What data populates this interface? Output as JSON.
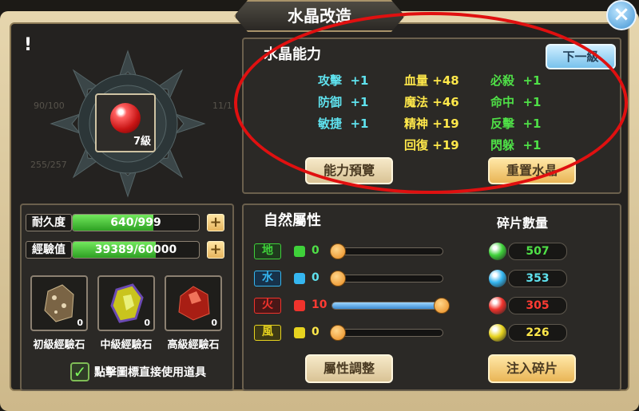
{
  "window": {
    "title": "水晶改造",
    "close_label": "×",
    "warning_label": "!"
  },
  "crystal": {
    "level_label": "7級"
  },
  "ghost_text": [
    "90/100",
    "11/1",
    "255/257"
  ],
  "ability": {
    "title": "水晶能力",
    "next_level_button": "下一級",
    "stats": [
      {
        "label": "攻擊",
        "value": "+1",
        "color": "cyan"
      },
      {
        "label": "防御",
        "value": "+1",
        "color": "cyan"
      },
      {
        "label": "敏捷",
        "value": "+1",
        "color": "cyan"
      },
      {
        "label": "血量",
        "value": "+48",
        "color": "yellow"
      },
      {
        "label": "魔法",
        "value": "+46",
        "color": "yellow"
      },
      {
        "label": "精神",
        "value": "+19",
        "color": "yellow"
      },
      {
        "label": "回復",
        "value": "+19",
        "color": "yellow"
      },
      {
        "label": "必殺",
        "value": "+1",
        "color": "green"
      },
      {
        "label": "命中",
        "value": "+1",
        "color": "green"
      },
      {
        "label": "反擊",
        "value": "+1",
        "color": "green"
      },
      {
        "label": "閃躲",
        "value": "+1",
        "color": "green"
      }
    ],
    "preview_button": "能力預覽",
    "reset_button": "重置水晶"
  },
  "durability": {
    "label": "耐久度",
    "text": "640/999",
    "current": 640,
    "max": 999,
    "plus": "+"
  },
  "experience": {
    "label": "經驗值",
    "text": "39389/60000",
    "current": 39389,
    "max": 60000,
    "plus": "+"
  },
  "exp_stones": [
    {
      "label": "初級經驗石",
      "count": "0",
      "icon": "brown-ore-icon"
    },
    {
      "label": "中級經驗石",
      "count": "0",
      "icon": "yellow-ore-icon"
    },
    {
      "label": "高級經驗石",
      "count": "0",
      "icon": "red-ore-icon"
    }
  ],
  "auto_use": {
    "checked": true,
    "label": "點擊圖標直接使用道具"
  },
  "attributes": {
    "title": "自然屬性",
    "shard_title": "碎片數量",
    "rows": [
      {
        "name": "地",
        "value": "0",
        "level": 0,
        "shards": "507",
        "color": "#3fd13a",
        "tag_bg": "#1f3a1d",
        "text_color": "#4fe047"
      },
      {
        "name": "水",
        "value": "0",
        "level": 0,
        "shards": "353",
        "color": "#35b6f0",
        "tag_bg": "#17324a",
        "text_color": "#5fe2ee"
      },
      {
        "name": "火",
        "value": "10",
        "level": 10,
        "shards": "305",
        "color": "#f0332c",
        "tag_bg": "#4a1717",
        "text_color": "#ff3b33"
      },
      {
        "name": "風",
        "value": "0",
        "level": 0,
        "shards": "226",
        "color": "#e7d31f",
        "tag_bg": "#3e3a14",
        "text_color": "#ffe84a"
      }
    ],
    "max_level": 10,
    "adjust_button": "屬性調整",
    "inject_button": "注入碎片"
  }
}
